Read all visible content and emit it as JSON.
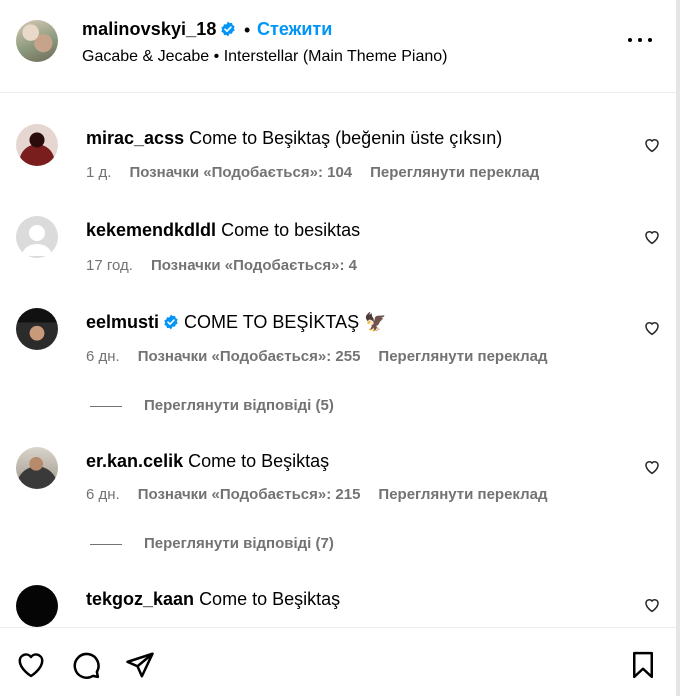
{
  "post": {
    "username": "malinovskyi_18",
    "follow_label": "Стежити",
    "separator": "•",
    "audio": "Gacabe & Jecabe • Interstellar (Main Theme Piano)"
  },
  "comments": [
    {
      "username": "mirac_acss",
      "text": "Come to Beşiktaş (beğenin üste çıksın)",
      "time": "1 д.",
      "likes": "Позначки «Подобається»: 104",
      "translate": "Переглянути переклад",
      "verified": false
    },
    {
      "username": "kekemendkdldl",
      "text": "Come to besiktas",
      "time": "17 год.",
      "likes": "Позначки «Подобається»: 4",
      "translate": "",
      "verified": false
    },
    {
      "username": "eelmusti",
      "text": "COME TO BEŞİKTAŞ 🦅",
      "time": "6 дн.",
      "likes": "Позначки «Подобається»: 255",
      "translate": "Переглянути переклад",
      "verified": true,
      "replies": "Переглянути відповіді (5)"
    },
    {
      "username": "er.kan.celik",
      "text": "Come to Beşiktaş",
      "time": "6 дн.",
      "likes": "Позначки «Подобається»: 215",
      "translate": "Переглянути переклад",
      "verified": false,
      "replies": "Переглянути відповіді (7)"
    },
    {
      "username": "tekgoz_kaan",
      "text": "Come to Beşiktaş",
      "verified": false
    }
  ],
  "icons": {
    "verified_color": "#0095f6",
    "follow_color": "#0095f6"
  }
}
